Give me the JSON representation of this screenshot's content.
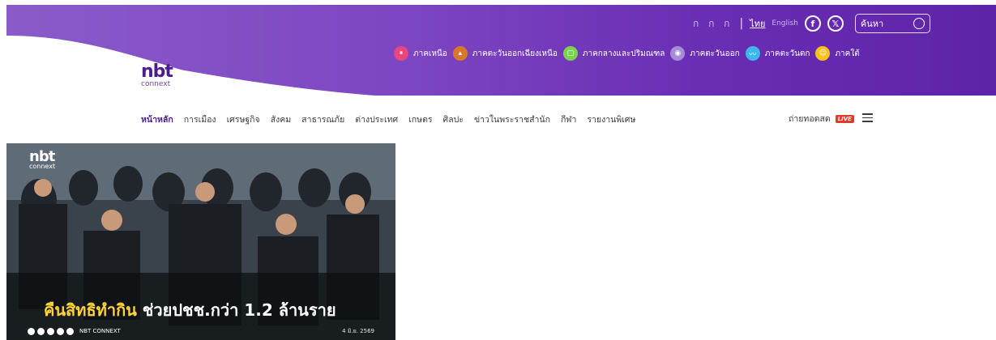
{
  "header": {
    "logo": {
      "main": "nbt",
      "sub": "connext"
    },
    "font_size_control": "ก ก ก",
    "separator": "|",
    "lang_th": "ไทย",
    "lang_en": "English",
    "social": {
      "facebook": "f",
      "x": "𝕏"
    },
    "search": {
      "placeholder": "ค้นหา"
    },
    "regions": [
      {
        "label": "ภาคเหนือ",
        "color": "#e8467c"
      },
      {
        "label": "ภาคตะวันออกเฉียงเหนือ",
        "color": "#d9772c"
      },
      {
        "label": "ภาคกลางและปริมณฑล",
        "color": "#7bd24e"
      },
      {
        "label": "ภาคตะวันออก",
        "color": "#a78bd6"
      },
      {
        "label": "ภาคตะวันตก",
        "color": "#3fb6ec"
      },
      {
        "label": "ภาคใต้",
        "color": "#f6c21c"
      }
    ]
  },
  "nav": {
    "items": [
      "หน้าหลัก",
      "การเมือง",
      "เศรษฐกิจ",
      "สังคม",
      "สาธารณภัย",
      "ต่างประเทศ",
      "เกษตร",
      "ศิลปะ",
      "ข่าวในพระราชสำนัก",
      "กีฬา",
      "รายงานพิเศษ"
    ],
    "live_label": "ถ่ายทอดสด",
    "live_badge": "LIVE"
  },
  "feature": {
    "logo_main": "nbt",
    "logo_sub": "connext",
    "headline_highlight": "คืนสิทธิทำกิน",
    "headline_rest": " ช่วยปชช.กว่า 1.2 ล้านราย",
    "brand": "NBT CONNEXT",
    "date": "4 มิ.ย. 2569"
  },
  "colors": {
    "header_purple": "#7d46c2",
    "logo_purple": "#4b1d91",
    "live_red": "#e23a2a",
    "highlight_yellow": "#ffd33a"
  }
}
